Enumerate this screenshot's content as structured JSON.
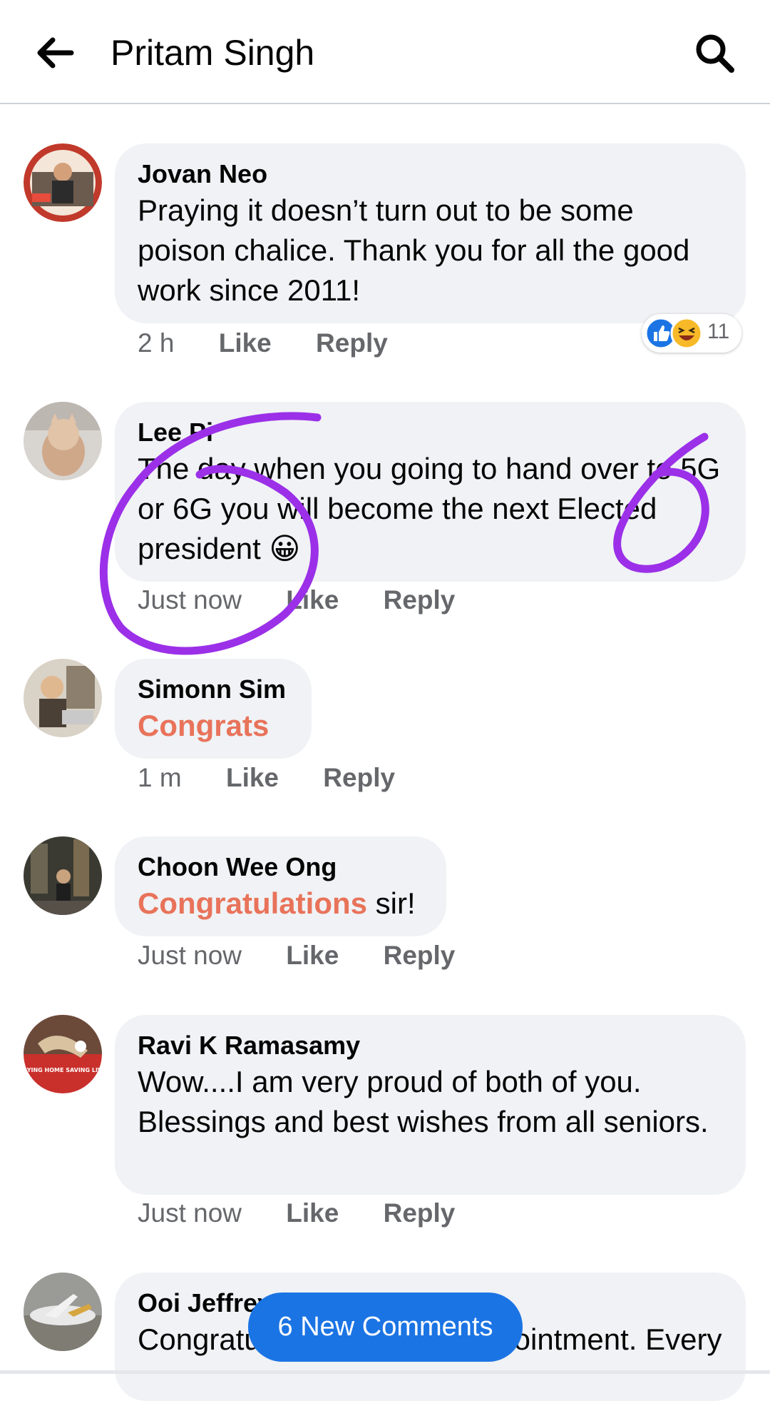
{
  "header": {
    "title": "Pritam Singh",
    "back_icon": "arrow-left-icon",
    "search_icon": "search-icon"
  },
  "comments": [
    {
      "author": "Jovan Neo",
      "text": "Praying it doesn’t turn out to be some poison chalice. Thank you for all the good work since 2011!",
      "time": "2 h",
      "like": "Like",
      "reply": "Reply",
      "reaction_count": "11",
      "reactions": [
        "like-icon",
        "haha-icon"
      ]
    },
    {
      "author": "Lee Pi",
      "text": "The day when you going to hand over to 5G or 6G you will become the next Elected president",
      "emoji": "😀",
      "time": "Just now",
      "like": "Like",
      "reply": "Reply"
    },
    {
      "author": "Simonn Sim",
      "text_highlight": "Congrats",
      "time": "1 m",
      "like": "Like",
      "reply": "Reply"
    },
    {
      "author": "Choon Wee Ong",
      "text_highlight": "Congratulations",
      "text_rest": " sir!",
      "time": "Just now",
      "like": "Like",
      "reply": "Reply"
    },
    {
      "author": "Ravi K Ramasamy",
      "text": "Wow....I am very proud of both of you. Blessings and best wishes from all seniors.",
      "time": "Just now",
      "like": "Like",
      "reply": "Reply",
      "avatar_text": "STAYING HOME SAVING LIVES"
    },
    {
      "author": "Ooi Jeffrey",
      "text": "Congratulations on your appointment. Every"
    }
  ],
  "new_comments_button": "6 New Comments",
  "colors": {
    "accent": "#1b74e4",
    "highlight": "#e8735a",
    "annotation": "#9b30e8"
  }
}
